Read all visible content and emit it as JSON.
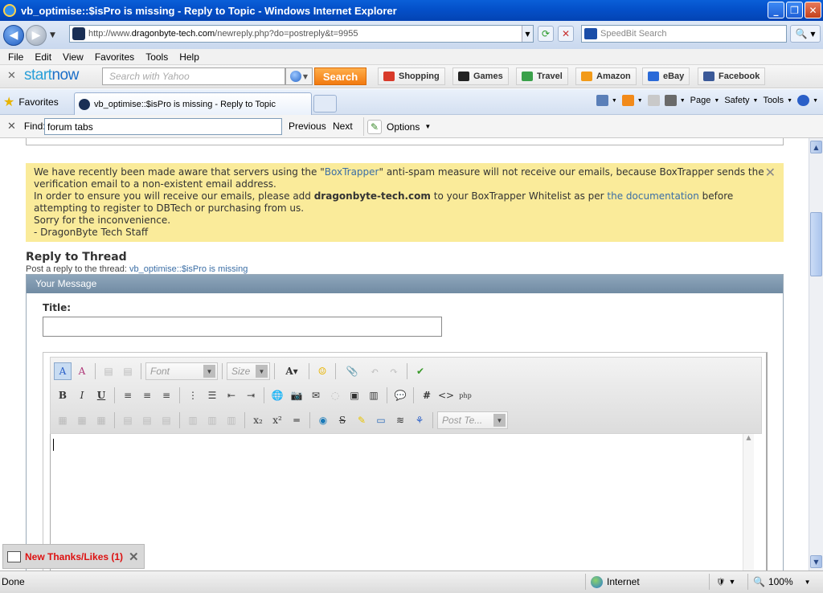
{
  "window": {
    "title": "vb_optimise::$isPro is missing - Reply to Topic - Windows Internet Explorer",
    "minimize": "_",
    "maximize": "❐",
    "close": "✕"
  },
  "address": {
    "url_prefix": "http://www.",
    "url_host": "dragonbyte-tech.com",
    "url_path": "/newreply.php?do=postreply&t=9955",
    "search_placeholder": "SpeedBit Search"
  },
  "menu": [
    "File",
    "Edit",
    "View",
    "Favorites",
    "Tools",
    "Help"
  ],
  "startnow": {
    "logo_start": "start",
    "logo_now": "now",
    "search_placeholder": "Search with Yahoo",
    "search_button": "Search",
    "links": [
      {
        "label": "Shopping",
        "color": "#d83a2a"
      },
      {
        "label": "Games",
        "color": "#222222"
      },
      {
        "label": "Travel",
        "color": "#3aa04a"
      },
      {
        "label": "Amazon",
        "color": "#f29a18"
      },
      {
        "label": "eBay",
        "color": "#2a6ad8"
      },
      {
        "label": "Facebook",
        "color": "#3b5998"
      }
    ]
  },
  "favorites": {
    "label": "Favorites",
    "tab_title": "vb_optimise::$isPro is missing - Reply to Topic",
    "commands": [
      "Page",
      "Safety",
      "Tools"
    ]
  },
  "find": {
    "label": "Find:",
    "value": "forum tabs",
    "previous": "Previous",
    "next": "Next",
    "options": "Options"
  },
  "notice": {
    "line1_pre": "We have recently been made aware that servers using the \"",
    "line1_link": "BoxTrapper",
    "line1_post": "\" anti-spam measure will not receive our emails, because BoxTrapper sends the verification email to a non-existent email address.",
    "line2_pre": "In order to ensure you will receive our emails, please add ",
    "line2_bold": "dragonbyte-tech.com",
    "line2_mid": " to your BoxTrapper Whitelist as per ",
    "line2_link": "the documentation",
    "line2_post": " before attempting to register to DBTech or purchasing from us.",
    "line3": "Sorry for the inconvenience.",
    "line4": "- DragonByte Tech Staff"
  },
  "reply": {
    "heading": "Reply to Thread",
    "sub_pre": "Post a reply to the thread: ",
    "sub_link": "vb_optimise::$isPro is missing",
    "panel_header": "Your Message",
    "title_label": "Title:"
  },
  "editor": {
    "font_placeholder": "Font",
    "size_placeholder": "Size",
    "post_template_placeholder": "Post Te..."
  },
  "thanks": {
    "label": "New Thanks/Likes (1)"
  },
  "status": {
    "text": "Done",
    "zone": "Internet",
    "zoom": "100%"
  }
}
